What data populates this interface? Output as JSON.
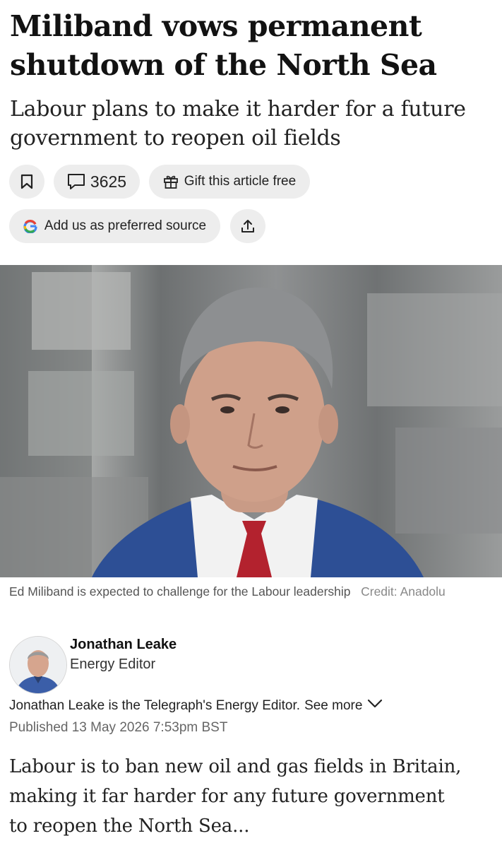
{
  "article": {
    "headline_line1": "Miliband vows permanent",
    "headline_line2": "shutdown of the North Sea",
    "standfirst": "Labour plans to make it harder for a future government to reopen oil fields",
    "actions": {
      "comment_count": "3625",
      "gift_label": "Gift this article free",
      "preferred_source_label": "Add us as preferred source"
    },
    "image": {
      "caption": "Ed Miliband is expected to challenge for the Labour leadership",
      "credit_label": "Credit:",
      "credit_name": "Anadolu"
    },
    "author": {
      "name": "Jonathan Leake",
      "role": "Energy Editor",
      "bio": "Jonathan Leake is the Telegraph's Energy Editor.",
      "see_more": "See more"
    },
    "published": "Published 13 May 2026 7:53pm BST",
    "body_line1": "Labour is to ban new oil and gas fields in Britain,",
    "body_line2": "making it far harder for any future government",
    "body_line3": "to reopen the North Sea..."
  },
  "icons": [
    "bookmark-icon",
    "comment-icon",
    "gift-icon",
    "google-icon",
    "share-icon",
    "chevron-down-icon"
  ],
  "colors": {
    "pill_bg": "#ededed",
    "jacket_blue": "#2d4f95",
    "tie_red": "#b3222e"
  }
}
